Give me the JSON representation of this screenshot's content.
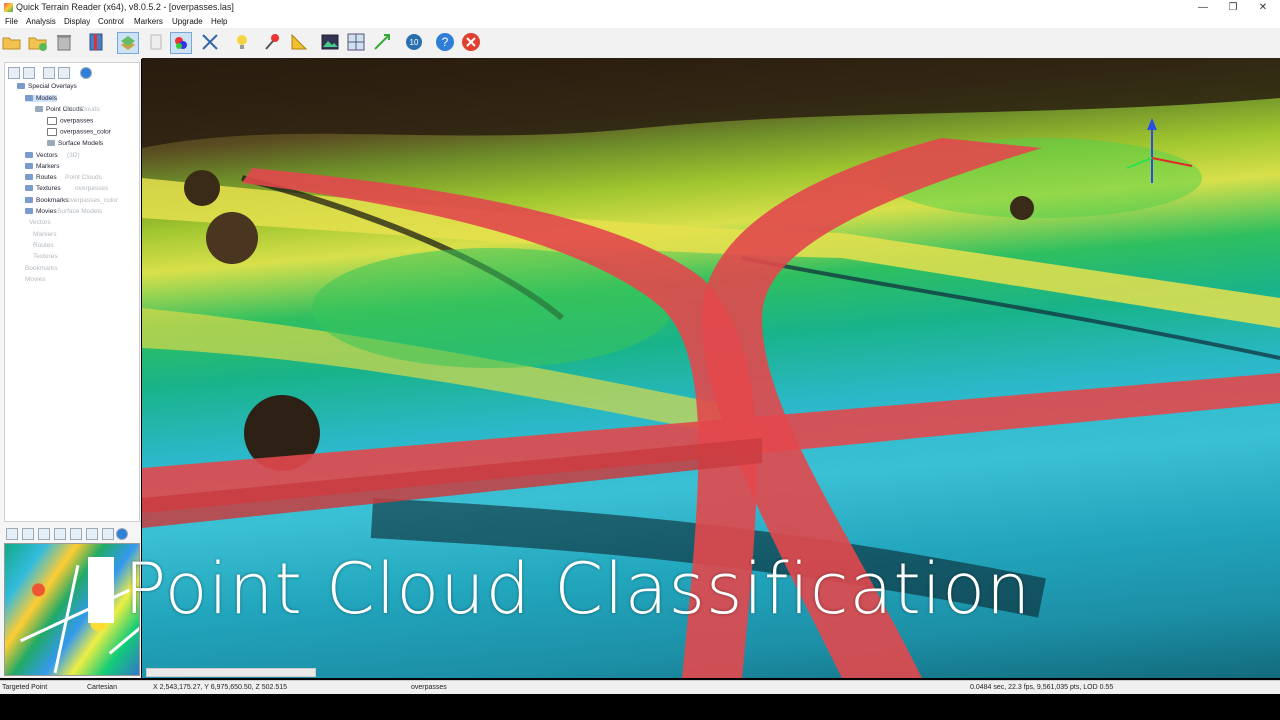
{
  "window": {
    "title": "Quick Terrain Reader (x64), v8.0.5.2 - [overpasses.las]",
    "minimize": "—",
    "maximize": "❐",
    "close": "✕"
  },
  "menu": [
    "File",
    "Analysis",
    "Display",
    "Control",
    "Markers",
    "Upgrade",
    "Help"
  ],
  "toolbar": {
    "icons": [
      "open-folder-icon",
      "add-folder-icon",
      "trash-icon",
      "bookmark-icon",
      "layers-icon",
      "page-icon",
      "color-palette-icon",
      "measure-icon",
      "lightbulb-icon",
      "pin-icon",
      "angle-icon",
      "image-icon",
      "grid-icon",
      "transform-icon",
      "recent-icon",
      "help-icon",
      "close-icon"
    ]
  },
  "tree": {
    "items": [
      {
        "label": "Special Overlays"
      },
      {
        "label": "Models"
      },
      {
        "label": "Point Clouds"
      },
      {
        "label": "overpasses"
      },
      {
        "label": "overpasses_color"
      },
      {
        "label": "Surface Models"
      },
      {
        "label": "Vectors"
      },
      {
        "label": "Markers"
      },
      {
        "label": "Routes"
      },
      {
        "label": "Textures"
      },
      {
        "label": "Bookmarks"
      },
      {
        "label": "Movies"
      }
    ],
    "ghost": [
      "Point Clouds",
      "(3D)",
      "Point Clouds",
      "overpasses",
      "overpasses_color",
      "Surface Models",
      "Vectors",
      "Markers",
      "Routes",
      "Textures",
      "Bookmarks",
      "Movies"
    ]
  },
  "caption": "Point Cloud Classification",
  "status": {
    "mode": "Targeted Point",
    "coord_system": "Cartesian",
    "coords": "X 2,543,175.27, Y 6,975,650.50, Z 502.515",
    "file": "overpasses",
    "perf": "0.0484 sec, 22.3 fps, 9,561,035 pts, LOD 0.55"
  },
  "colors": {
    "overpass_red": "#e2484c",
    "ground_green": "#2fbf60",
    "water_cyan": "#2bb8c9",
    "road_yellow": "#d8e04a"
  }
}
